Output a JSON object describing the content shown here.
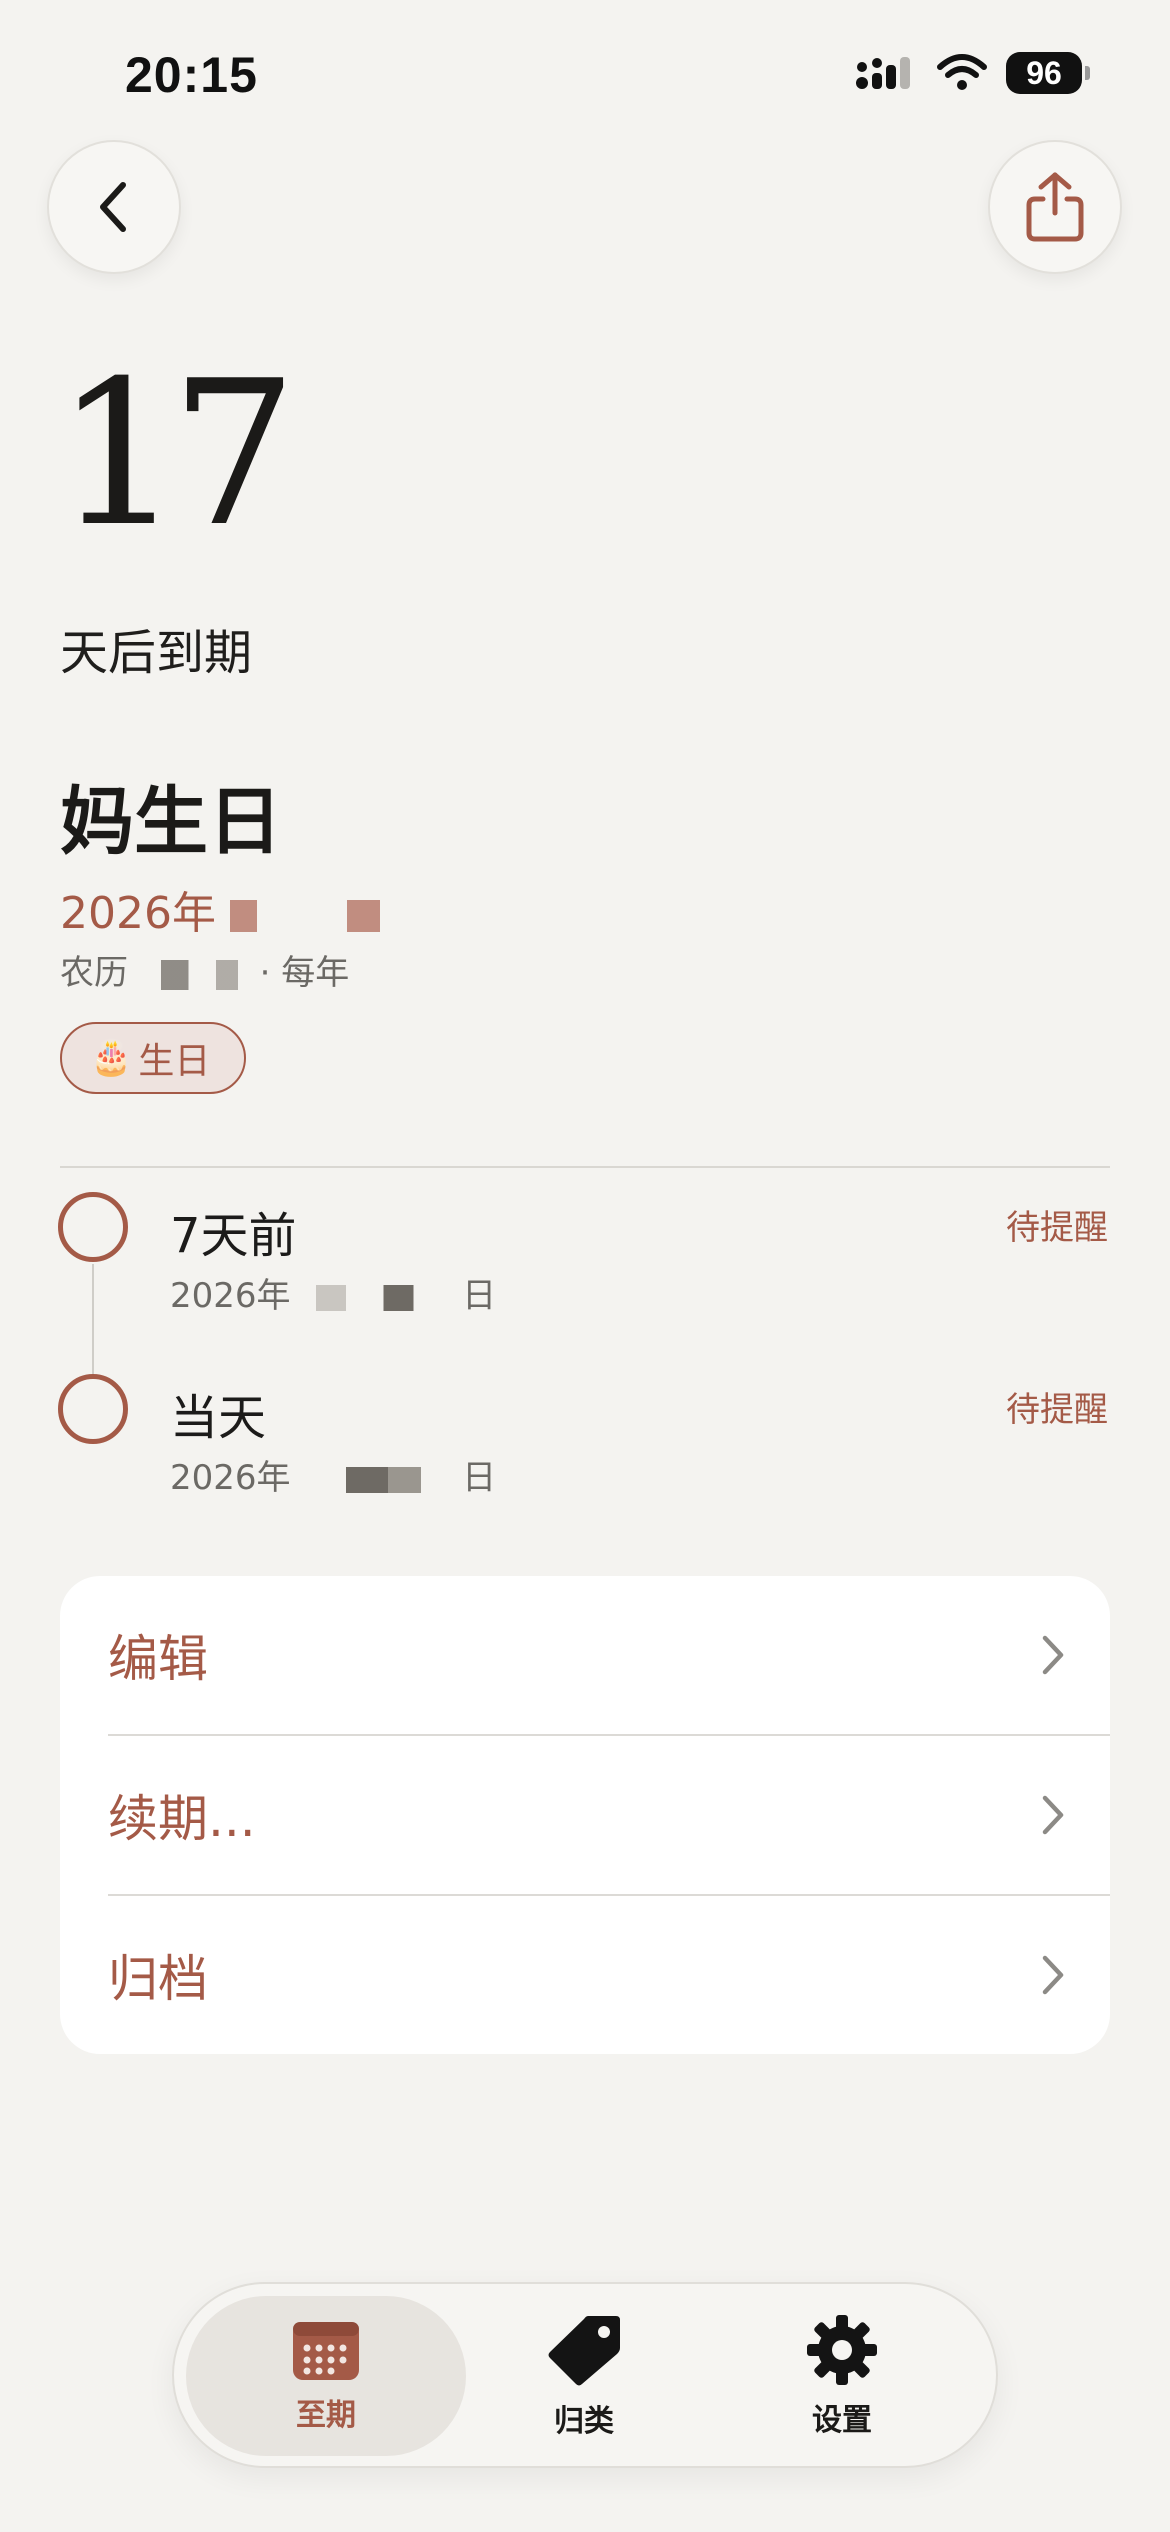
{
  "status_bar": {
    "time": "20:15",
    "battery": "96"
  },
  "event": {
    "days_remaining": "17",
    "days_label": "天后到期",
    "title": "妈生日",
    "date": "2026年",
    "lunar": "农历",
    "repeat": "· 每年",
    "tag": {
      "emoji": "🎂",
      "label": "生日"
    }
  },
  "reminders": [
    {
      "title": "7天前",
      "date": "2026年",
      "date_suffix": "日",
      "status": "待提醒"
    },
    {
      "title": "当天",
      "date": "2026年",
      "date_suffix": "日",
      "status": "待提醒"
    }
  ],
  "actions": [
    {
      "label": "编辑"
    },
    {
      "label": "续期..."
    },
    {
      "label": "归档"
    }
  ],
  "tabbar": {
    "tabs": [
      {
        "label": "至期",
        "icon": "calendar-icon",
        "active": true
      },
      {
        "label": "归类",
        "icon": "tag-icon",
        "active": false
      },
      {
        "label": "设置",
        "icon": "gear-icon",
        "active": false
      }
    ]
  },
  "colors": {
    "accent": "#a45a47",
    "background": "#f4f3f0",
    "card": "#ffffff"
  }
}
